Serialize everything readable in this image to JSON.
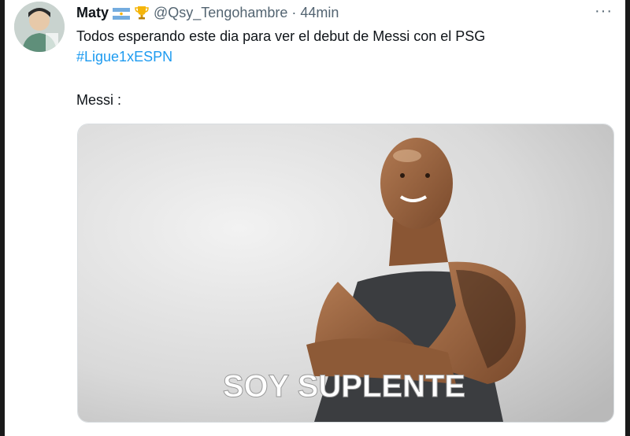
{
  "tweet": {
    "display_name": "Maty",
    "handle": "@Qsy_Tengohambre",
    "separator": "·",
    "time": "44min",
    "more_label": "···",
    "text_line1": "Todos esperando este dia para ver el debut de Messi con el PSG",
    "hashtag": "#Ligue1xESPN",
    "text_line3": "Messi :"
  },
  "media": {
    "caption": "SOY SUPLENTE"
  },
  "icons": {
    "flag": "argentina-flag-icon",
    "trophy": "trophy-icon",
    "more": "more-options-icon"
  },
  "colors": {
    "hashtag": "#1d9bf0",
    "muted": "#536471",
    "text": "#0f1419"
  }
}
